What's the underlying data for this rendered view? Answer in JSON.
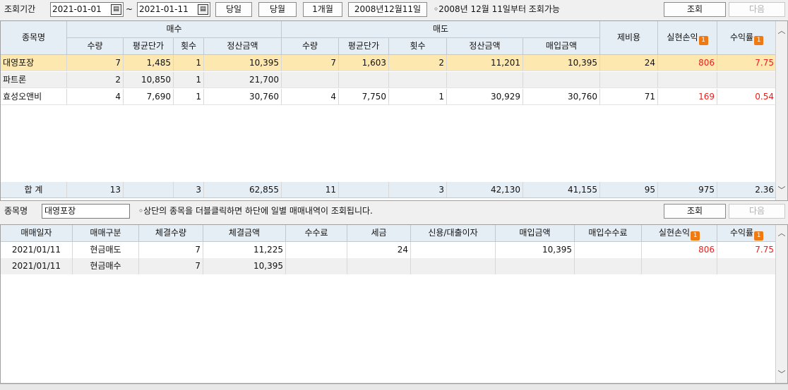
{
  "toolbar": {
    "period_label": "조회기간",
    "date_from": "2021-01-01",
    "tilde": "~",
    "date_to": "2021-01-11",
    "btn_today": "당일",
    "btn_month": "당월",
    "btn_1month": "1개월",
    "btn_date": "2008년12월11일",
    "note": "◦2008년 12월 11일부터 조회가능",
    "btn_search": "조회",
    "btn_next": "다음"
  },
  "top_grid": {
    "headers": {
      "stock": "종목명",
      "buy_group": "매수",
      "sell_group": "매도",
      "fee": "제비용",
      "profit": "실현손익",
      "rate": "수익률",
      "buy_qty": "수량",
      "buy_avg": "평균단가",
      "buy_count": "횟수",
      "buy_amount": "정산금액",
      "sell_qty": "수량",
      "sell_avg": "평균단가",
      "sell_count": "횟수",
      "sell_amount": "정산금액",
      "sell_purchase": "매입금액"
    },
    "rows": [
      {
        "stock": "대영포장",
        "buy_qty": "7",
        "buy_avg": "1,485",
        "buy_count": "1",
        "buy_amount": "10,395",
        "sell_qty": "7",
        "sell_avg": "1,603",
        "sell_count": "2",
        "sell_amount": "11,201",
        "sell_purchase": "10,395",
        "fee": "24",
        "profit": "806",
        "rate": "7.75"
      },
      {
        "stock": "파트론",
        "buy_qty": "2",
        "buy_avg": "10,850",
        "buy_count": "1",
        "buy_amount": "21,700",
        "sell_qty": "",
        "sell_avg": "",
        "sell_count": "",
        "sell_amount": "",
        "sell_purchase": "",
        "fee": "",
        "profit": "",
        "rate": ""
      },
      {
        "stock": "효성오앤비",
        "buy_qty": "4",
        "buy_avg": "7,690",
        "buy_count": "1",
        "buy_amount": "30,760",
        "sell_qty": "4",
        "sell_avg": "7,750",
        "sell_count": "1",
        "sell_amount": "30,929",
        "sell_purchase": "30,760",
        "fee": "71",
        "profit": "169",
        "rate": "0.54"
      }
    ],
    "total": {
      "label": "합 계",
      "buy_qty": "13",
      "buy_count": "3",
      "buy_amount": "62,855",
      "sell_qty": "11",
      "sell_count": "3",
      "sell_amount": "42,130",
      "sell_purchase": "41,155",
      "fee": "95",
      "profit": "975",
      "rate": "2.36"
    }
  },
  "midbar": {
    "stock_label": "종목명",
    "stock_value": "대영포장",
    "note": "◦상단의 종목을 더블클릭하면 하단에 일별 매매내역이 조회됩니다.",
    "btn_search": "조회",
    "btn_next": "다음"
  },
  "bottom_grid": {
    "headers": {
      "date": "매매일자",
      "type": "매매구분",
      "qty": "체결수량",
      "amount": "체결금액",
      "commission": "수수료",
      "tax": "세금",
      "interest": "신용/대출이자",
      "purchase": "매입금액",
      "purchase_fee": "매입수수료",
      "profit": "실현손익",
      "rate": "수익률"
    },
    "rows": [
      {
        "date": "2021/01/11",
        "type": "현금매도",
        "qty": "7",
        "amount": "11,225",
        "commission": "",
        "tax": "24",
        "interest": "",
        "purchase": "10,395",
        "purchase_fee": "",
        "profit": "806",
        "rate": "7.75"
      },
      {
        "date": "2021/01/11",
        "type": "현금매수",
        "qty": "7",
        "amount": "10,395",
        "commission": "",
        "tax": "",
        "interest": "",
        "purchase": "",
        "purchase_fee": "",
        "profit": "",
        "rate": ""
      }
    ]
  },
  "icons": {
    "calendar": "calendar-icon",
    "badge": "info-badge-icon",
    "scroll_up": "scroll-up-icon",
    "scroll_down": "scroll-down-icon"
  },
  "colors": {
    "selected_row": "#fde9b0",
    "header_bg": "#e6eef5",
    "profit_red": "#e8201e",
    "badge_orange": "#f07a12"
  }
}
